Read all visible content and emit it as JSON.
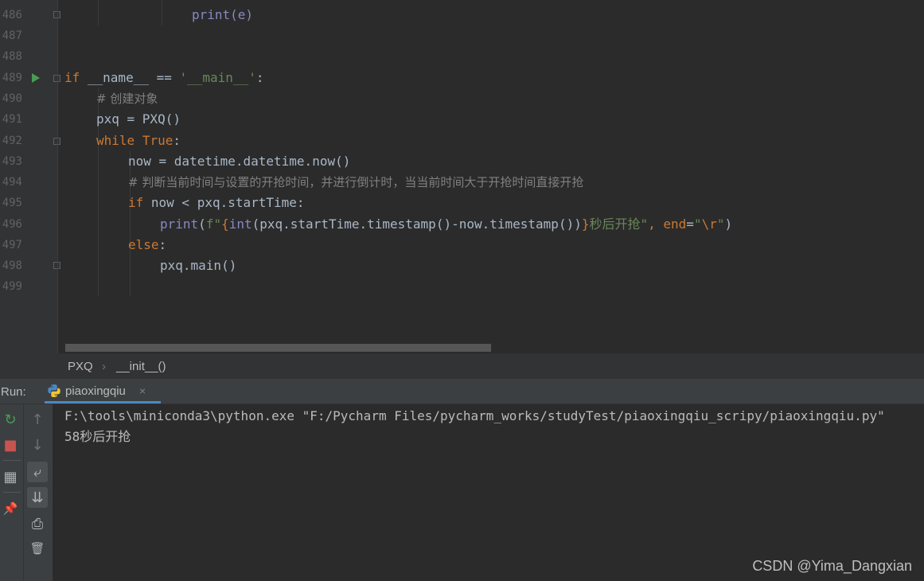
{
  "editor": {
    "line_numbers": [
      "486",
      "487",
      "488",
      "489",
      "490",
      "491",
      "492",
      "493",
      "494",
      "495",
      "496",
      "497",
      "498",
      "499"
    ],
    "code_lines": {
      "l486": "print(e)",
      "l489_if": "if",
      "l489_rest": " __name__ == ",
      "l489_str": "'__main__'",
      "l489_colon": ":",
      "l490": "# 创建对象",
      "l491": "pxq = PXQ()",
      "l492_while": "while",
      "l492_true": "True",
      "l492_colon": ":",
      "l493": "now = datetime.datetime.now()",
      "l494": "# 判断当前时间与设置的开抢时间，并进行倒计时，当当前时间大于开抢时间直接开抢",
      "l495_if": "if",
      "l495_rest": " now < pxq.startTime:",
      "l496_print": "print",
      "l496_p1": "(",
      "l496_f": "f\"",
      "l496_brace1": "{",
      "l496_int": "int",
      "l496_mid": "(pxq.startTime.timestamp()-now.timestamp())",
      "l496_brace2": "}",
      "l496_tail": "秒后开抢\"",
      "l496_comma": ", ",
      "l496_end": "end",
      "l496_eq": "=",
      "l496_rstr1": "\"",
      "l496_esc": "\\r",
      "l496_rstr2": "\"",
      "l496_close": ")",
      "l497": "else",
      "l497_colon": ":",
      "l498": "pxq.main()"
    }
  },
  "breadcrumbs": {
    "class_name": "PXQ",
    "separator": "›",
    "method_name": "__init__()"
  },
  "run_panel": {
    "label": "Run:",
    "tab_label": "piaoxingqiu",
    "tab_close": "×",
    "console_lines": [
      "F:\\tools\\miniconda3\\python.exe \"F:/Pycharm Files/pycharm_works/studyTest/piaoxingqiu_scripy/piaoxingqiu.py\"",
      "58秒后开抢"
    ]
  },
  "toolbar_icons": {
    "rerun": "↻",
    "stop": "■",
    "layout": "▦",
    "pin": "📌",
    "up": "↑",
    "down": "↓",
    "soft_wrap": "⤶",
    "scroll_end": "⇊",
    "print": "⎙",
    "trash": "🗑"
  },
  "colors": {
    "keyword": "#cc7832",
    "string": "#6a8759",
    "builtin": "#8888c6",
    "comment": "#808080",
    "accent": "#4a88c7"
  },
  "watermark": "CSDN @Yima_Dangxian"
}
